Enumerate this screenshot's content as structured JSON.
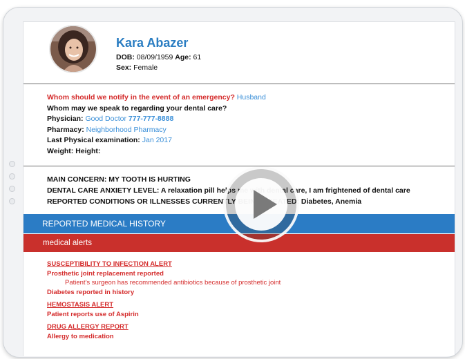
{
  "patient": {
    "name": "Kara Abazer",
    "dob_label": "DOB:",
    "dob": "08/09/1959",
    "age_label": "Age:",
    "age": "61",
    "sex_label": "Sex:",
    "sex": "Female"
  },
  "contact": {
    "emergency_q": "Whom should we notify in the event of an emergency?",
    "emergency_a": "Husband",
    "speak_q": "Whom may we speak to regarding your dental care?",
    "physician_label": "Physician:",
    "physician_name": "Good Doctor",
    "physician_phone": "777-777-8888",
    "pharmacy_label": "Pharmacy:",
    "pharmacy": "Neighborhood Pharmacy",
    "last_exam_label": "Last Physical examination:",
    "last_exam": "Jan 2017",
    "weight_height": "Weight: Height:"
  },
  "concerns": {
    "line1": "MAIN CONCERN: MY TOOTH IS HURTING",
    "line2": "DENTAL CARE ANXIETY LEVEL: A relaxation pill helps me with dental care, I am frightened of dental care",
    "line3": "REPORTED CONDITIONS OR ILLNESSES CURRENTLY BEING TREATED: Diabetes, Anemia"
  },
  "sections": {
    "history_title": "REPORTED MEDICAL HISTORY",
    "alerts_title": "medical alerts"
  },
  "alerts": {
    "a1_title": "SUSCEPTIBILITY TO INFECTION ALERT",
    "a1_line1": "Prosthetic joint replacement reported",
    "a1_note": "Patient's surgeon has recommended antibiotics because of prosthetic joint",
    "a1_line2": "Diabetes reported in history",
    "a2_title": "HEMOSTASIS ALERT",
    "a2_line1": "Patient reports use of Aspirin",
    "a3_title": "DRUG ALLERGY REPORT",
    "a3_line1": "Allergy to medication"
  },
  "icons": {
    "play": "play-icon",
    "avatar": "avatar"
  },
  "colors": {
    "name": "#2a7dc2",
    "alert_red": "#d42b2b",
    "link_blue": "#3a8fd8",
    "history_bar": "#2b7cc5",
    "alerts_bar": "#c9302c"
  }
}
